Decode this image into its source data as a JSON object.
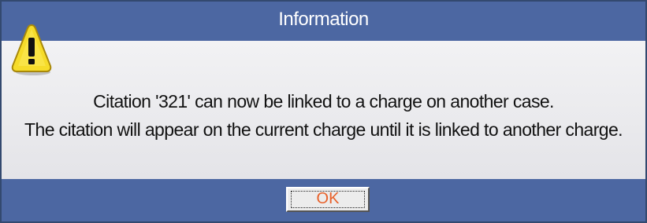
{
  "dialog": {
    "title": "Information",
    "icon": "warning-icon",
    "message_line1": "Citation '321' can now be linked to a charge on another case.",
    "message_line2": "The citation will appear on the current charge until it is linked to another charge.",
    "ok_label": "OK"
  },
  "colors": {
    "titlebar": "#4c67a2",
    "body": "#e8e8ec",
    "ok_text": "#e8612a",
    "warning_yellow": "#f6dc2a"
  }
}
